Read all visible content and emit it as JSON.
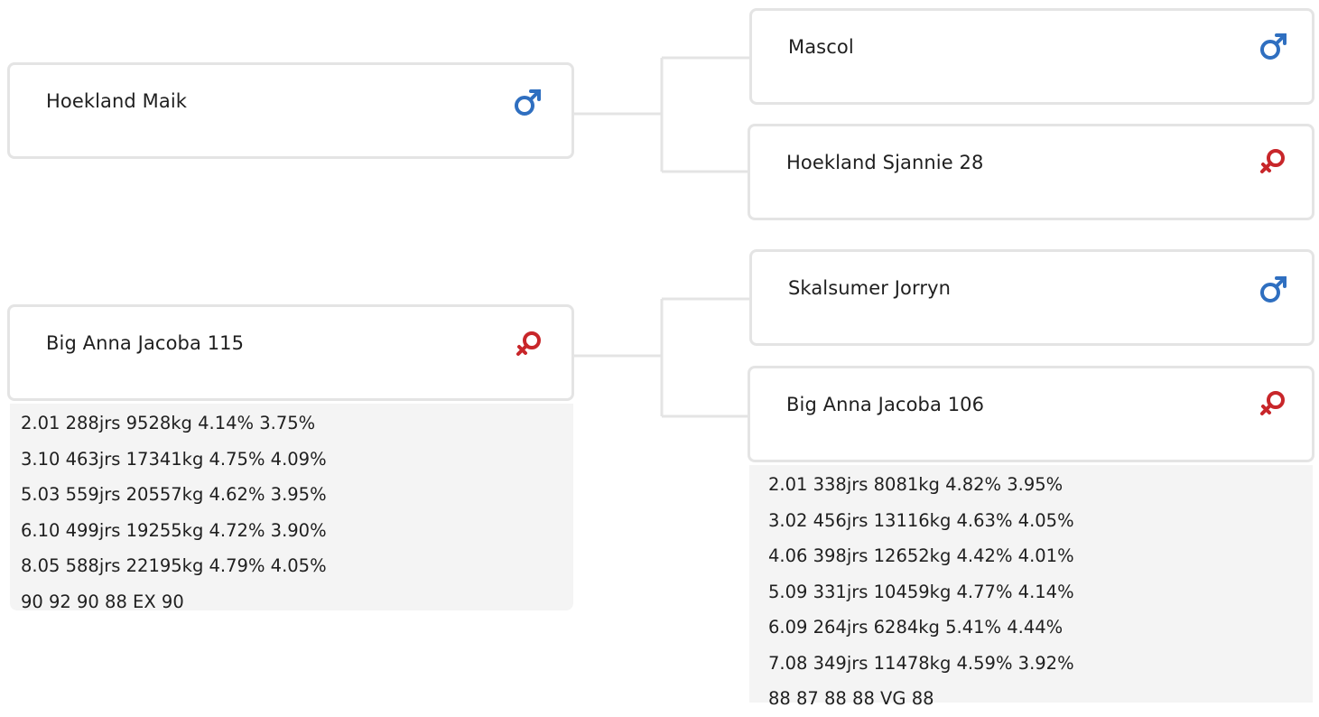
{
  "animals": {
    "sire": {
      "name": "Hoekland Maik",
      "sex_icon": "male-icon"
    },
    "dam": {
      "name": "Big Anna Jacoba 115",
      "sex_icon": "female-icon",
      "stats": [
        "2.01 288jrs 9528kg 4.14% 3.75%",
        "3.10 463jrs 17341kg 4.75% 4.09%",
        "5.03 559jrs 20557kg 4.62% 3.95%",
        "6.10 499jrs 19255kg 4.72% 3.90%",
        "8.05 588jrs 22195kg 4.79% 4.05%",
        "90 92 90 88 EX 90"
      ]
    },
    "sire_sire": {
      "name": "Mascol",
      "sex_icon": "male-icon"
    },
    "sire_dam": {
      "name": "Hoekland Sjannie 28",
      "sex_icon": "female-icon"
    },
    "dam_sire": {
      "name": "Skalsumer Jorryn",
      "sex_icon": "male-icon"
    },
    "dam_dam": {
      "name": "Big Anna Jacoba 106",
      "sex_icon": "female-icon",
      "stats": [
        "2.01 338jrs 8081kg 4.82% 3.95%",
        "3.02 456jrs 13116kg 4.63% 4.05%",
        "4.06 398jrs 12652kg 4.42% 4.01%",
        "5.09 331jrs 10459kg 4.77% 4.14%",
        "6.09 264jrs 6284kg 5.41% 4.44%",
        "7.08 349jrs 11478kg 4.59% 3.92%",
        "88 87 88 88 VG 88"
      ]
    }
  },
  "colors": {
    "male": "#2f6fc0",
    "female": "#c8262a",
    "border": "#e4e4e4",
    "stats_bg": "#f4f4f4"
  }
}
